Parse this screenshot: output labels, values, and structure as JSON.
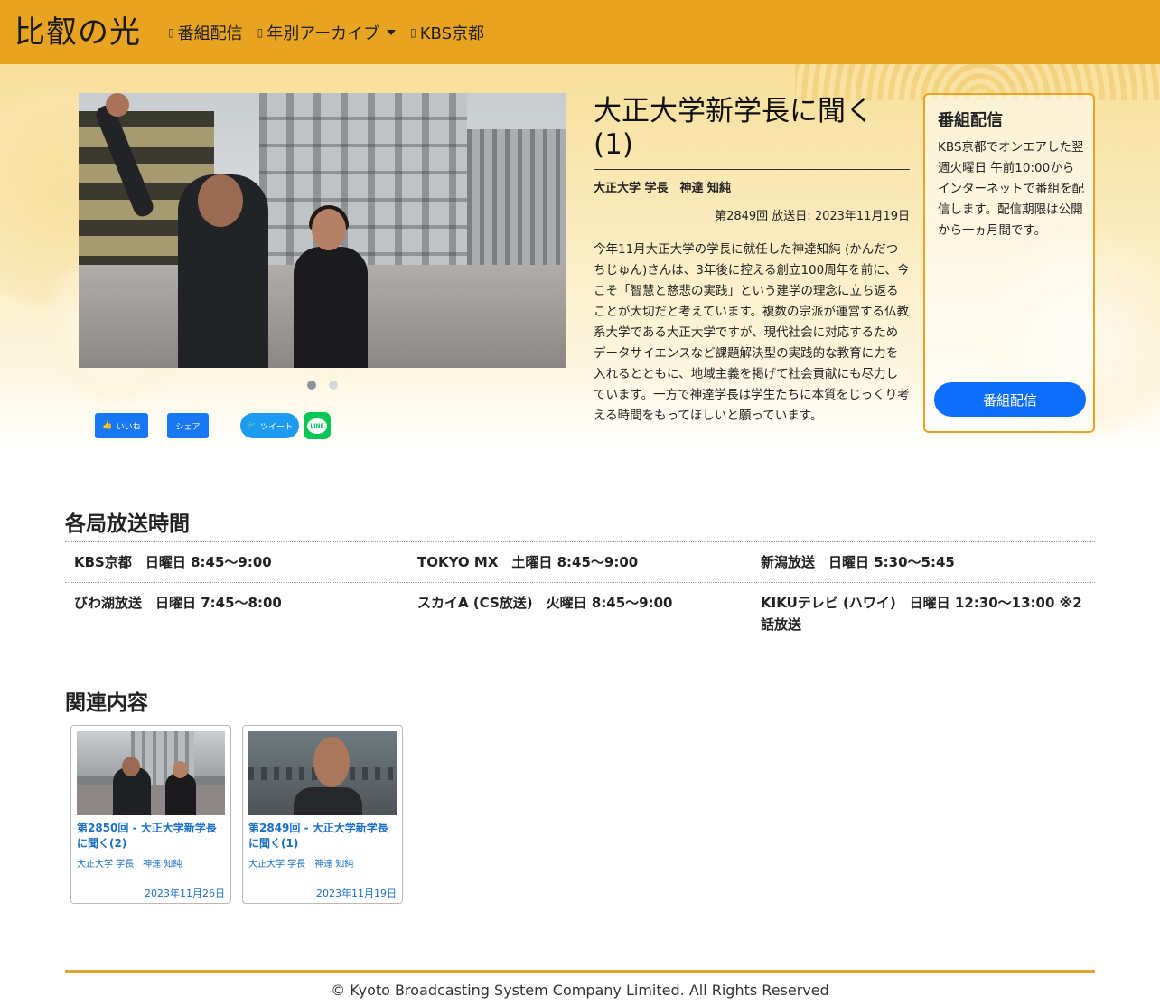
{
  "navbar": {
    "brand": "比叡の光",
    "items": [
      {
        "icon": "broadcast-icon",
        "label": "番組配信"
      },
      {
        "icon": "archive-icon",
        "label": "年別アーカイブ"
      },
      {
        "icon": "tv-icon",
        "label": "KBS京都"
      }
    ]
  },
  "carousel": {
    "slides": 2,
    "active_index": 0
  },
  "social": {
    "fb_like": "いいね",
    "fb_share": "シェア",
    "tweet": "ツイート",
    "line": "LINE"
  },
  "episode": {
    "title": "大正大学新学長に聞く(1)",
    "guest": "大正大学 学長　神達 知純",
    "meta": "第2849回 放送日: 2023年11月19日",
    "description": "今年11月大正大学の学長に就任した神達知純 (かんだつ ちじゅん)さんは、3年後に控える創立100周年を前に、今こそ「智慧と慈悲の実践」という建学の理念に立ち返ることが大切だと考えています。複数の宗派が運営する仏教系大学である大正大学ですが、現代社会に対応するためデータサイエンスなど課題解決型の実践的な教育に力を入れるとともに、地域主義を掲げて社会貢献にも尽力しています。一方で神達学長は学生たちに本質をじっくり考える時間をもってほしいと願っています。"
  },
  "side_card": {
    "title": "番組配信",
    "text": "KBS京都でオンエアした翌週火曜日 午前10:00からインターネットで番組を配信します。配信期限は公開から一ヵ月間です。",
    "button": "番組配信"
  },
  "broadcast": {
    "title": "各局放送時間",
    "rows": [
      [
        "KBS京都　日曜日 8:45〜9:00",
        "TOKYO MX　土曜日 8:45〜9:00",
        "新潟放送　日曜日 5:30〜5:45"
      ],
      [
        "びわ湖放送　日曜日 7:45〜8:00",
        "スカイA (CS放送)　火曜日 8:45〜9:00",
        "KIKUテレビ (ハワイ)　日曜日 12:30〜13:00 ※2話放送"
      ]
    ]
  },
  "related": {
    "title": "関連内容",
    "items": [
      {
        "title": "第2850回 - 大正大学新学長に聞く(2)",
        "guest": "大正大学 学長　神達 知純",
        "date": "2023年11月26日"
      },
      {
        "title": "第2849回 - 大正大学新学長に聞く(1)",
        "guest": "大正大学 学長　神達 知純",
        "date": "2023年11月19日"
      }
    ]
  },
  "footer": {
    "copyright": "© Kyoto Broadcasting System Company Limited. All Rights Reserved"
  },
  "colors": {
    "accent": "#e8a421",
    "link": "#1b6fc7",
    "primary_button": "#0d6efd"
  }
}
